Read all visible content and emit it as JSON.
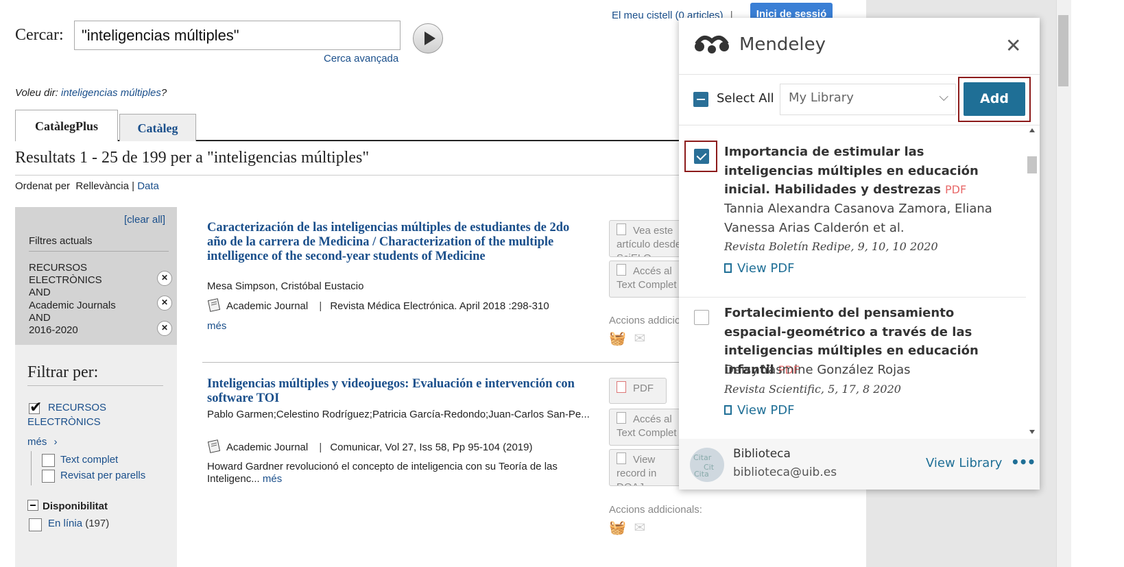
{
  "header": {
    "cart_link": "El meu cistell (0 articles)",
    "separator": "|",
    "login_button": "Inici de sessió"
  },
  "search": {
    "label": "Cercar:",
    "query": "\"inteligencias múltiples\"",
    "advanced_link": "Cerca avançada",
    "did_you_mean_prefix": "Voleu dir:",
    "did_you_mean_link": "inteligencias múltiples",
    "did_you_mean_suffix": "?"
  },
  "tabs": [
    {
      "label": "CatàlegPlus",
      "active": true
    },
    {
      "label": "Catàleg",
      "active": false
    }
  ],
  "results_heading": "Resultats 1 - 25 de 199 per a \"inteligencias múltiples\"",
  "sort": {
    "label": "Ordenat per",
    "current": "Rellevància",
    "separator": "|",
    "alt": "Data"
  },
  "sidebar": {
    "clear_all": "[clear all]",
    "current_filters_title": "Filtres actuals",
    "current_filters": [
      "RECURSOS ELECTRÒNICS",
      "AND",
      "Academic Journals",
      "AND",
      "2016-2020"
    ],
    "filter_by_title": "Filtrar per:",
    "recursos_label": "RECURSOS ELECTRÒNICS",
    "mes_link": "més",
    "text_complet": "Text complet",
    "revisat": "Revisat per parells",
    "disponibilitat": "Disponibilitat",
    "en_linia": "En línia",
    "en_linia_count": "(197)"
  },
  "results": [
    {
      "title": "Caracterización de las inteligencias múltiples de estudiantes de 2do año de la carrera de Medicina / Characterization of the multiple intelligence of the second-year students of Medicine",
      "authors": "Mesa Simpson, Cristóbal Eustacio",
      "type": "Academic Journal",
      "source": "Revista Médica Electrónica. April 2018 :298-310",
      "more": "més",
      "buttons": [
        "Vea este artículo desde SciELO",
        "Accés al Text Complet"
      ],
      "actions_label": "Accions addicionals:"
    },
    {
      "title": "Inteligencias múltiples y videojuegos: Evaluación e intervención con software TOI",
      "authors": "Pablo Garmen;Celestino Rodríguez;Patricia García-Redondo;Juan-Carlos San-Pe...",
      "type": "Academic Journal",
      "source": "Comunicar, Vol 27, Iss 58, Pp 95-104 (2019)",
      "abstract": "Howard Gardner revolucionó el concepto de inteligencia con su Teoría de las Inteligenc...",
      "more": "més",
      "buttons": [
        "PDF",
        "Accés al Text Complet",
        "View record in DOAJ"
      ],
      "actions_label": "Accions addicionals:"
    }
  ],
  "mendeley": {
    "brand": "Mendeley",
    "close": "✕",
    "select_all": "Select All",
    "library_select": "My Library",
    "add_button": "Add",
    "items": [
      {
        "title": "Importancia de estimular las inteligencias múltiples en educación inicial. Habilidades y destrezas",
        "pdf_badge": "PDF",
        "authors": "Tannia Alexandra Casanova Zamora, Eliana Vanessa Arias Calderón et al.",
        "journal": "Revista Boletín Redipe, 9, 10, 10 2020",
        "view_pdf": "View PDF",
        "checked": true
      },
      {
        "title": "Fortalecimiento del pensamiento espacial-geométrico a través de las inteligencias múltiples en educación infantil",
        "pdf_badge": "PDF",
        "authors": "Deisy Yasmine González Rojas",
        "journal": "Revista Scientific, 5, 17, 8 2020",
        "view_pdf": "View PDF",
        "checked": false
      }
    ],
    "footer": {
      "user_name": "Biblioteca",
      "user_email": "biblioteca@uib.es",
      "view_library": "View Library",
      "more": "•••"
    }
  }
}
